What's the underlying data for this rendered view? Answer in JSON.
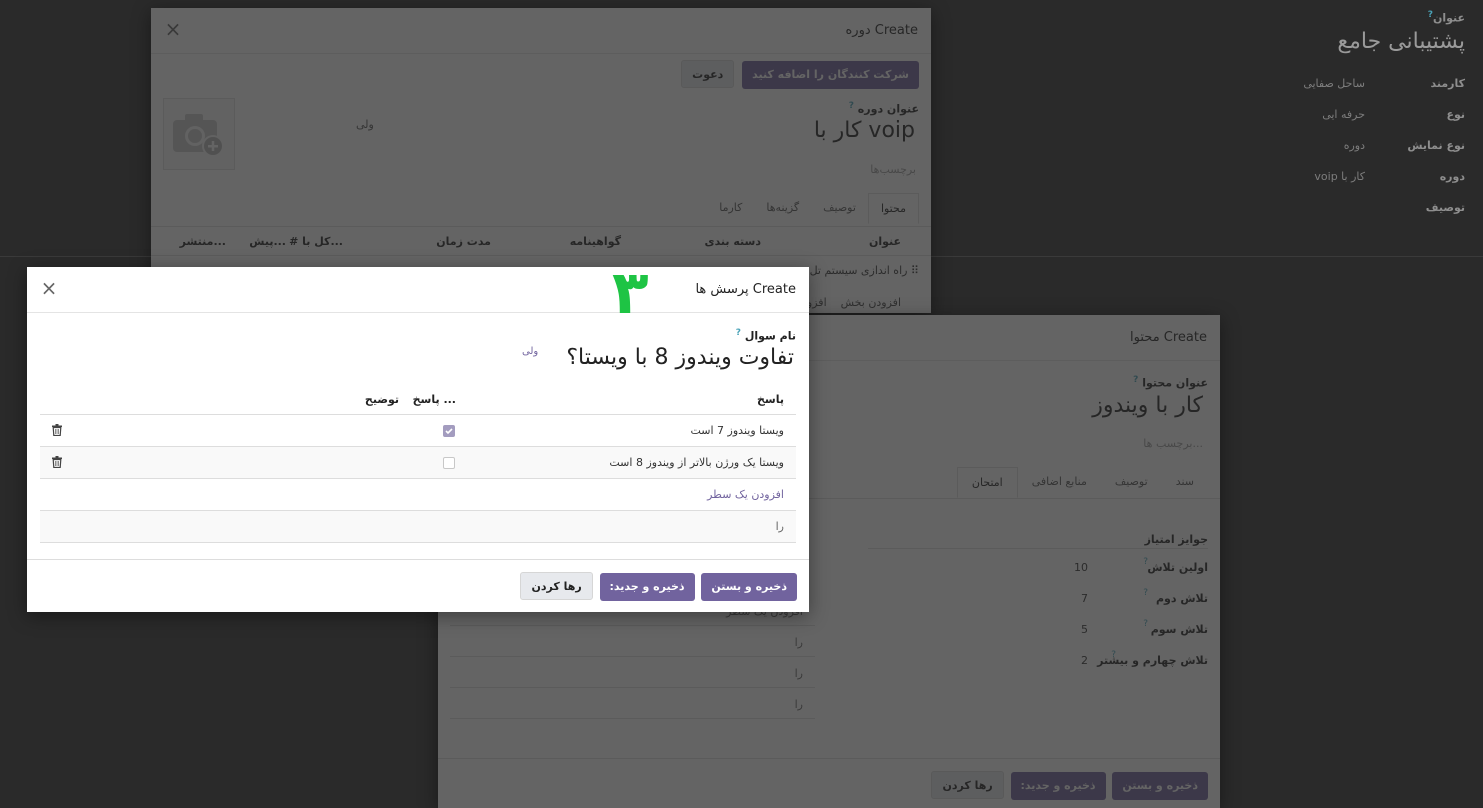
{
  "background": {
    "title_label": "عنوان",
    "title": "پشتیبانی جامع",
    "fields": [
      {
        "label": "کارمند",
        "value": "ساحل صفایی"
      },
      {
        "label": "نوع",
        "value": "حرفه ایی"
      },
      {
        "label": "نوع نمایش",
        "value": "دوره"
      },
      {
        "label": "دوره",
        "value": "کار با voip"
      },
      {
        "label": "توصیف",
        "value": ""
      }
    ]
  },
  "course_modal": {
    "title": "Create دوره",
    "add_participants": "شرکت کنندگان را اضافه کنید",
    "invite": "دعوت",
    "name_label": "عنوان دوره",
    "name": "کار با voip",
    "tags": "برچسب‌ها",
    "user": "ولی",
    "tabs": [
      "محتوا",
      "توصیف",
      "گزینه‌ها",
      "کارما"
    ],
    "columns": [
      "عنوان",
      "دسته بندی",
      "گواهینامه",
      "مدت زمان",
      "# کل با...",
      "پیش...",
      "منتشر..."
    ],
    "row_title": "راه اندازی سیستم تل",
    "add_section": "افزودن بخش",
    "add_line": "افزود"
  },
  "content_modal": {
    "title": "Create محتوا",
    "name_label": "عنوان محتوا",
    "name": "کار با ویندوز",
    "tags": "برچسب ها...",
    "tabs": [
      "سند",
      "توصیف",
      "منابع اضافی",
      "امتحان"
    ],
    "rewards_header": "جوایز امتیاز",
    "rewards": [
      {
        "label": "اولین تلاش",
        "value": "10"
      },
      {
        "label": "تلاش دوم",
        "value": "7"
      },
      {
        "label": "تلاش سوم",
        "value": "5"
      },
      {
        "label": "تلاش چهارم و بیشتر",
        "value": "2"
      }
    ],
    "lines": [
      "افزودن یک سطر",
      "را",
      "را",
      "را"
    ],
    "footer": {
      "save_close": "ذخیره و بستن",
      "save_new": "ذخیره و جدید:",
      "discard": "رها کردن"
    }
  },
  "question_modal": {
    "title": "Create پرسش ها",
    "step_number": "۳",
    "name_label": "نام سوال",
    "name": "تفاوت ویندوز 8 با ویستا؟",
    "user": "ولی",
    "columns": {
      "answer": "پاسخ",
      "correct": "پاسخ ...",
      "comment": "توضیح"
    },
    "answers": [
      {
        "text": "ویستا ویندوز 7 است",
        "correct": true
      },
      {
        "text": "ویستا یک ورژن بالاتر از ویندوز 8 است",
        "correct": false
      }
    ],
    "add_line": "افزودن یک سطر",
    "empty_row": "را",
    "footer": {
      "save_close": "ذخیره و بستن",
      "save_new": "ذخیره و جدید:",
      "discard": "رها کردن"
    }
  }
}
